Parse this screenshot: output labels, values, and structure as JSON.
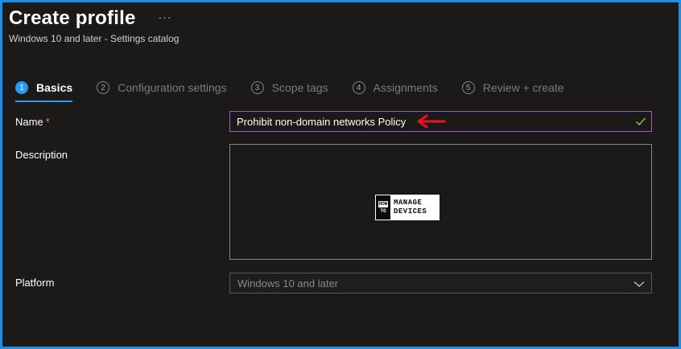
{
  "header": {
    "title": "Create profile",
    "more_label": "···",
    "subtitle": "Windows 10 and later - Settings catalog"
  },
  "wizard": {
    "steps": [
      {
        "number": "1",
        "label": "Basics",
        "active": true
      },
      {
        "number": "2",
        "label": "Configuration settings",
        "active": false
      },
      {
        "number": "3",
        "label": "Scope tags",
        "active": false
      },
      {
        "number": "4",
        "label": "Assignments",
        "active": false
      },
      {
        "number": "5",
        "label": "Review + create",
        "active": false
      }
    ]
  },
  "form": {
    "name_label": "Name",
    "required_marker": "*",
    "name_value": "Prohibit non-domain networks Policy",
    "description_label": "Description",
    "description_value": "",
    "platform_label": "Platform",
    "platform_value": "Windows 10 and later"
  },
  "watermark": {
    "left_top": "HOW",
    "left_bottom": "TO",
    "right_top": "MANAGE",
    "right_bottom": "DEVICES"
  },
  "colors": {
    "accent": "#2899f5",
    "frame_border": "#1e8fe6",
    "input_focus_border": "#a05bd4",
    "valid_check": "#92c353",
    "annotation_arrow": "#e81123",
    "required": "#f1707b"
  },
  "icons": {
    "more": "more-horizontal-icon",
    "valid": "checkmark-icon",
    "dropdown": "chevron-down-icon",
    "annotation": "arrow-left-icon"
  }
}
